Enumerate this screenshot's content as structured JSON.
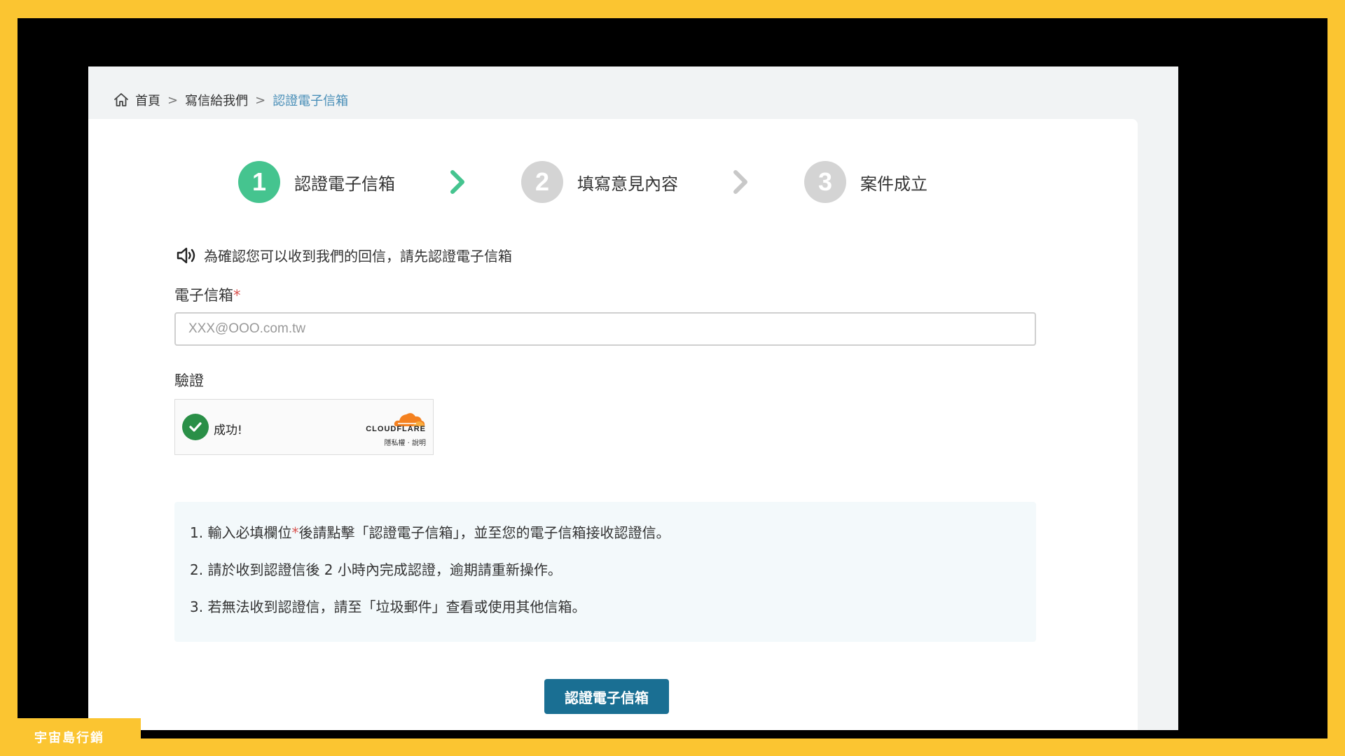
{
  "breadcrumb": {
    "items": [
      "首頁",
      "寫信給我們"
    ],
    "current": "認證電子信箱",
    "separator": ">"
  },
  "steps": [
    {
      "number": "1",
      "label": "認證電子信箱",
      "state": "active"
    },
    {
      "number": "2",
      "label": "填寫意見內容",
      "state": "inactive"
    },
    {
      "number": "3",
      "label": "案件成立",
      "state": "inactive"
    }
  ],
  "notice": "為確認您可以收到我們的回信，請先認證電子信箱",
  "form": {
    "email_label": "電子信箱",
    "required_mark": "*",
    "email_placeholder": "XXX@OOO.com.tw",
    "email_value": "",
    "verify_label": "驗證"
  },
  "turnstile": {
    "status": "成功!",
    "brand": "CLOUDFLARE",
    "links": "隱私權 · 說明"
  },
  "instructions": [
    {
      "num": "1.",
      "before": "輸入必填欄位",
      "mark": "*",
      "after": "後請點擊「認證電子信箱」，並至您的電子信箱接收認證信。"
    },
    {
      "num": "2.",
      "text": "請於收到認證信後 2 小時內完成認證，逾期請重新操作。"
    },
    {
      "num": "3.",
      "text": "若無法收到認證信，請至「垃圾郵件」查看或使用其他信箱。"
    }
  ],
  "submit_label": "認證電子信箱",
  "watermark": "宇宙島行銷",
  "colors": {
    "active_step": "#45c48f",
    "inactive_step": "#d4d4d4",
    "primary_button": "#1a6f93",
    "breadcrumb_current": "#4a8fb8",
    "required": "#d9534f",
    "frame_border": "#fbc531"
  }
}
